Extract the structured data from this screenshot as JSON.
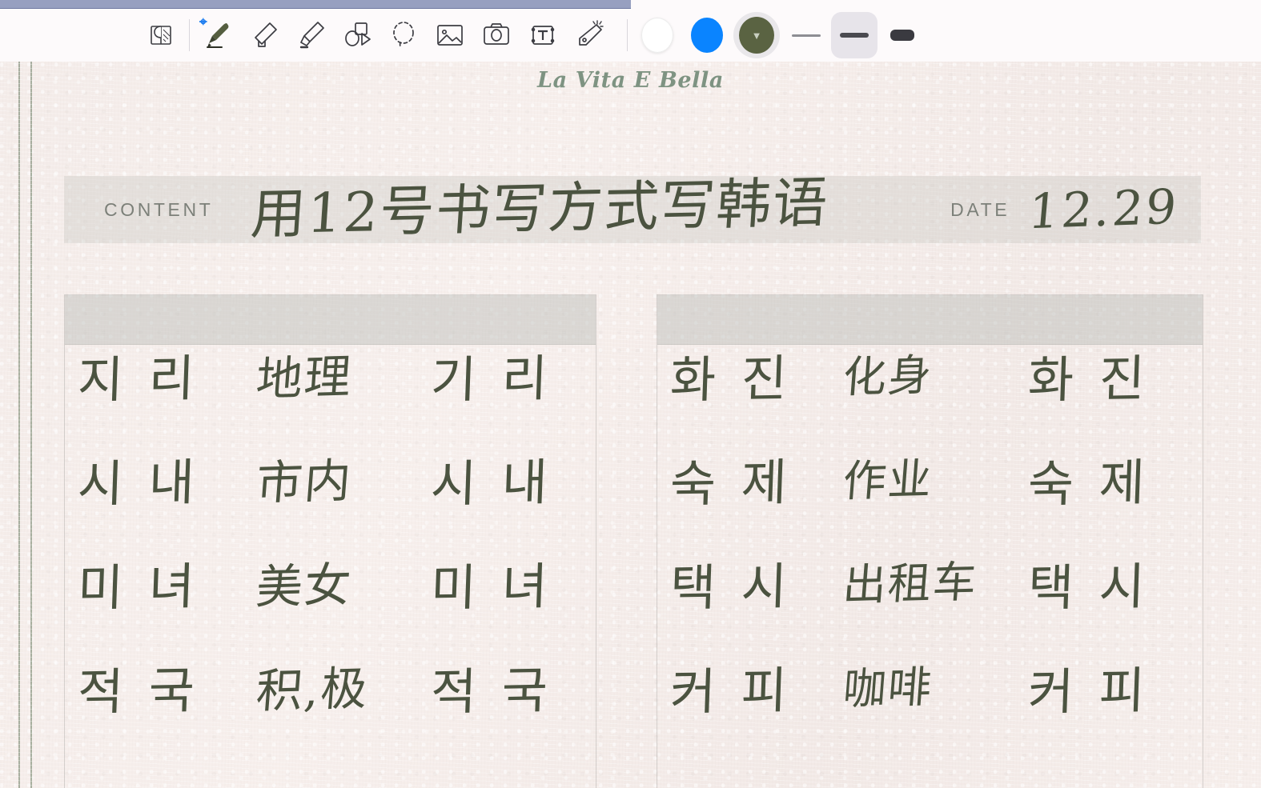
{
  "window": {
    "progress_percent": 50
  },
  "toolbar": {
    "tools": [
      {
        "name": "page-flip-icon",
        "label": "Page"
      },
      {
        "name": "pen-icon",
        "label": "Pen",
        "active": true,
        "badge": "bluetooth"
      },
      {
        "name": "eraser-icon",
        "label": "Eraser"
      },
      {
        "name": "highlighter-icon",
        "label": "Highlighter"
      },
      {
        "name": "shapes-icon",
        "label": "Shapes"
      },
      {
        "name": "lasso-icon",
        "label": "Lasso Select"
      },
      {
        "name": "image-icon",
        "label": "Insert Image"
      },
      {
        "name": "camera-icon",
        "label": "Camera"
      },
      {
        "name": "text-box-icon",
        "label": "Text Box"
      },
      {
        "name": "sticker-icon",
        "label": "Sticker"
      }
    ],
    "colors": [
      {
        "name": "color-white",
        "hex": "#ffffff",
        "selected": false
      },
      {
        "name": "color-blue",
        "hex": "#0a84ff",
        "selected": false
      },
      {
        "name": "color-olive",
        "hex": "#5a6342",
        "selected": true
      }
    ],
    "strokes": [
      {
        "name": "stroke-thin",
        "size": "thin",
        "selected": false
      },
      {
        "name": "stroke-medium",
        "size": "medium",
        "selected": true
      },
      {
        "name": "stroke-thick",
        "size": "thick",
        "selected": false
      }
    ]
  },
  "page": {
    "brand": "La Vita E Bella",
    "content_label": "CONTENT",
    "content_value": "用12号书写方式写韩语",
    "date_label": "DATE",
    "date_value": "12.29",
    "columns": [
      {
        "name": "left-column",
        "rows": [
          {
            "korean": "지 리",
            "chinese": "地理",
            "korean_repeat": "기 리"
          },
          {
            "korean": "시 내",
            "chinese": "市内",
            "korean_repeat": "시 내"
          },
          {
            "korean": "미 녀",
            "chinese": "美女",
            "korean_repeat": "미 녀"
          },
          {
            "korean": "적 국",
            "chinese": "积,极",
            "korean_repeat": "적 국"
          }
        ]
      },
      {
        "name": "right-column",
        "rows": [
          {
            "korean": "화 진",
            "chinese": "化身",
            "korean_repeat": "화 진"
          },
          {
            "korean": "숙 제",
            "chinese": "作业",
            "korean_repeat": "숙 제"
          },
          {
            "korean": "택 시",
            "chinese": "出租车",
            "korean_repeat": "택 시"
          },
          {
            "korean": "커 피",
            "chinese": "咖啡",
            "korean_repeat": "커 피"
          }
        ]
      }
    ]
  }
}
